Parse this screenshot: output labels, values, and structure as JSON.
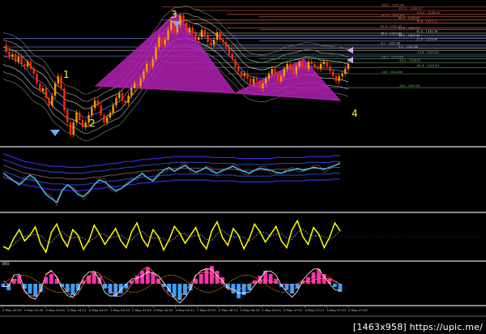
{
  "chart_data": [
    {
      "type": "line",
      "panel": "price",
      "series": [
        {
          "values": [
            1325,
            1322,
            1320,
            1321,
            1318,
            1320,
            1317,
            1316,
            1318,
            1315,
            1313,
            1309,
            1306,
            1307,
            1303,
            1300,
            1304,
            1309,
            1312,
            1307,
            1298,
            1293,
            1288,
            1293,
            1297,
            1294,
            1291,
            1293,
            1296,
            1299,
            1302,
            1300,
            1296,
            1293,
            1295,
            1297,
            1300,
            1303,
            1305,
            1302,
            1301,
            1304,
            1307,
            1309,
            1308,
            1311,
            1314,
            1317,
            1316,
            1319,
            1324,
            1328,
            1325,
            1327,
            1331,
            1335,
            1330,
            1333,
            1337,
            1334,
            1330,
            1332,
            1330,
            1327,
            1328,
            1331,
            1329,
            1326,
            1325,
            1327,
            1330,
            1327,
            1326,
            1324,
            1321,
            1319,
            1316,
            1314,
            1312,
            1313,
            1311,
            1309,
            1311,
            1310,
            1307,
            1309,
            1311,
            1313,
            1315,
            1313,
            1310,
            1312,
            1315,
            1317,
            1315,
            1313,
            1316,
            1318,
            1316,
            1315,
            1318,
            1317,
            1316,
            1315,
            1317,
            1318,
            1316,
            1314,
            1312,
            1310,
            1312,
            1313,
            1315,
            1317
          ]
        }
      ],
      "pattern_labels": [
        "1",
        "2",
        "3",
        "4"
      ],
      "pattern_points_y": [
        1330,
        1308,
        1338,
        1305,
        1319,
        1314,
        1302
      ],
      "levels": [
        {
          "label": "138.2 - 1341.44",
          "value": 1340.5
        },
        {
          "label": "127.2 - 1339.25",
          "value": 1339.0
        },
        {
          "label": "100.0 - 1338.04",
          "value": 1337.4
        },
        {
          "label": "127.2 - 1337.49",
          "value": 1336.4
        },
        {
          "label": "88.6 - 1336.09",
          "value": 1335.2
        },
        {
          "label": "78.6 - 1335.11",
          "value": 1333.9
        },
        {
          "label": "61.8 - 1332.15",
          "value": 1331.8
        },
        {
          "label": "61.8 - 1332.07",
          "value": 1331.2
        },
        {
          "label": "50.0 - 1330.76",
          "value": 1329.7
        },
        {
          "label": "38.2 - 1329.85",
          "value": 1328.9
        },
        {
          "label": "38.2 - 1329.36",
          "value": 1328.0
        },
        {
          "label": "23.6 - 1328.40",
          "value": 1326.5
        },
        {
          "label": "0.0 - 1325.86",
          "value": 1324.8
        },
        {
          "label": "0.0 - 1324.68",
          "value": 1323.4
        },
        {
          "label": "-23.6 - 1322.65",
          "value": 1321.0
        },
        {
          "label": "-38.2 - 1320.66",
          "value": 1319.2
        },
        {
          "label": "-50.0 - 1318.81",
          "value": 1317.6
        },
        {
          "label": "-61.8 - 1316.40",
          "value": 1315.6
        },
        {
          "label": "-100 - 1312.68",
          "value": 1313.0
        },
        {
          "label": "-161 - 1307.05",
          "value": 1307.3
        }
      ],
      "colors": {
        "pattern": "#b020b0",
        "up_candle": "#ff9a00",
        "down_candle": "#ff2a00",
        "band": "#d8d8d8",
        "level_hi": "#ff7a5a",
        "level_lo": "#7ac07a",
        "blue_level": "#6a8aff"
      }
    },
    {
      "type": "line",
      "panel": "indicator-cyan",
      "series": [
        {
          "values": [
            52,
            48,
            44,
            40,
            45,
            50,
            46,
            38,
            30,
            26,
            22,
            34,
            40,
            36,
            30,
            28,
            33,
            40,
            45,
            43,
            38,
            34,
            36,
            40,
            44,
            48,
            52,
            47,
            44,
            50,
            55,
            58,
            54,
            57,
            60,
            56,
            53,
            55,
            58,
            54,
            52,
            55,
            57,
            59,
            56,
            54,
            52,
            55,
            57,
            56,
            55,
            53,
            52,
            54,
            55,
            57,
            55,
            56,
            58,
            57,
            56,
            58,
            60,
            62
          ]
        },
        {
          "values": [
            60,
            58,
            56,
            54,
            52,
            51,
            50,
            49,
            48,
            47,
            47,
            47,
            46,
            46,
            46,
            46,
            47,
            48,
            48,
            49,
            50,
            50,
            51,
            52,
            52,
            53,
            54,
            54,
            55,
            55,
            56,
            56,
            57,
            57,
            57,
            57,
            57,
            57,
            57,
            56,
            56,
            56,
            56,
            56,
            55,
            55,
            55,
            55,
            55,
            55,
            55,
            56,
            56,
            56,
            56,
            56,
            56,
            57,
            57,
            57,
            57,
            57,
            58,
            58
          ]
        }
      ],
      "colors": {
        "main": "#3ac6ff",
        "band": "#1c3aff"
      }
    },
    {
      "type": "line",
      "panel": "indicator-yellow",
      "series": [
        {
          "values": [
            40,
            35,
            55,
            70,
            50,
            60,
            75,
            45,
            30,
            65,
            80,
            55,
            40,
            70,
            60,
            35,
            50,
            78,
            62,
            44,
            58,
            72,
            50,
            38,
            66,
            82,
            54,
            40,
            70,
            58,
            34,
            52,
            76,
            64,
            46,
            60,
            74,
            48,
            36,
            68,
            84,
            56,
            42,
            72,
            60,
            36,
            54,
            80,
            66,
            48,
            62,
            76,
            50,
            38,
            70,
            86,
            58,
            44,
            74,
            62,
            38,
            56,
            82,
            68
          ]
        }
      ],
      "colors": {
        "main": "#ffff00",
        "signal": "#a0a0a0"
      }
    },
    {
      "type": "bar",
      "panel": "histogram",
      "values": [
        -2,
        -4,
        3,
        5,
        -3,
        -6,
        -8,
        -5,
        4,
        6,
        3,
        -2,
        -5,
        -7,
        -4,
        2,
        5,
        7,
        4,
        -3,
        -6,
        -8,
        -6,
        -3,
        2,
        5,
        8,
        10,
        7,
        3,
        -2,
        -5,
        -8,
        -10,
        -7,
        -4,
        3,
        6,
        9,
        11,
        8,
        4,
        -3,
        -6,
        -9,
        -7,
        -4,
        2,
        5,
        8,
        6,
        3,
        -2,
        -4,
        -6,
        -3,
        2,
        4,
        7,
        9,
        6,
        3,
        -2,
        -5
      ],
      "colors": {
        "positive": "#ff2fa8",
        "negative": "#3aa0ff",
        "line_a": "#ff6a6a",
        "line_b": "#ffffff"
      }
    }
  ],
  "axis_labels": [
    "5 May 03:33",
    "5 May 03:49",
    "5 May 04:05",
    "5 May 04:21",
    "5 May 04:37",
    "5 May 04:53",
    "5 May 05:09",
    "5 May 05:25",
    "5 May 05:41",
    "5 May 05:57",
    "5 May 06:13",
    "5 May 06:29",
    "5 May 06:45",
    "5 May 07:01",
    "5 May 07:17",
    "5 May 07:33",
    "5 May 07:49"
  ],
  "histogram_panel_label": "360",
  "watermark": "[1463x958] https://upic.me/"
}
